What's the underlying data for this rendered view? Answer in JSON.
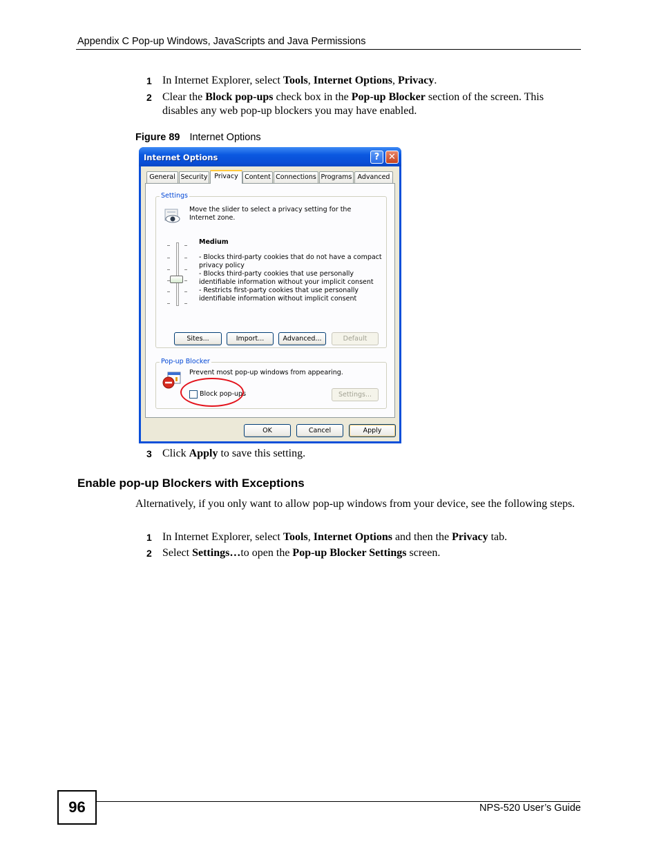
{
  "header": {
    "title": "Appendix C Pop-up Windows, JavaScripts and Java Permissions"
  },
  "steps_a": [
    {
      "num": "1",
      "parts": [
        {
          "t": "In Internet Explorer, select "
        },
        {
          "t": "Tools",
          "b": true
        },
        {
          "t": ", "
        },
        {
          "t": "Internet Options",
          "b": true
        },
        {
          "t": ", "
        },
        {
          "t": "Privacy",
          "b": true
        },
        {
          "t": "."
        }
      ]
    },
    {
      "num": "2",
      "parts": [
        {
          "t": "Clear the "
        },
        {
          "t": "Block pop-ups",
          "b": true
        },
        {
          "t": " check box in the "
        },
        {
          "t": "Pop-up Blocker",
          "b": true
        },
        {
          "t": " section of the screen. This disables any web pop-up blockers you may have enabled."
        }
      ]
    }
  ],
  "figure": {
    "label": "Figure 89",
    "title": "Internet Options"
  },
  "dialog": {
    "title": "Internet Options",
    "help_glyph": "?",
    "close_glyph": "✕",
    "tabs": [
      "General",
      "Security",
      "Privacy",
      "Content",
      "Connections",
      "Programs",
      "Advanced"
    ],
    "selected_tab": "Privacy",
    "settings": {
      "group_label": "Settings",
      "intro": "Move the slider to select a privacy setting for the Internet zone.",
      "level": "Medium",
      "descriptions": [
        "- Blocks third-party cookies that do not have a compact privacy policy",
        "- Blocks third-party cookies that use personally identifiable information without your implicit consent",
        "- Restricts first-party cookies that use personally identifiable information without implicit consent"
      ],
      "buttons": {
        "sites": "Sites...",
        "import": "Import...",
        "advanced": "Advanced...",
        "default": "Default"
      }
    },
    "popup_blocker": {
      "group_label": "Pop-up Blocker",
      "text": "Prevent most pop-up windows from appearing.",
      "checkbox_label": "Block pop-ups",
      "checkbox_checked": false,
      "settings_button": "Settings..."
    },
    "footer_buttons": {
      "ok": "OK",
      "cancel": "Cancel",
      "apply": "Apply"
    }
  },
  "step_3": {
    "num": "3",
    "parts": [
      {
        "t": "Click "
      },
      {
        "t": "Apply",
        "b": true
      },
      {
        "t": " to save this setting."
      }
    ]
  },
  "section": {
    "heading": "Enable pop-up Blockers with Exceptions",
    "paragraph": "Alternatively, if you only want to allow pop-up windows from your device, see the following steps."
  },
  "steps_b": [
    {
      "num": "1",
      "parts": [
        {
          "t": "In Internet Explorer, select "
        },
        {
          "t": "Tools",
          "b": true
        },
        {
          "t": ", "
        },
        {
          "t": "Internet Options",
          "b": true
        },
        {
          "t": " and then the "
        },
        {
          "t": "Privacy",
          "b": true
        },
        {
          "t": " tab."
        }
      ]
    },
    {
      "num": "2",
      "parts": [
        {
          "t": "Select "
        },
        {
          "t": "Settings…",
          "b": true
        },
        {
          "t": "to open the "
        },
        {
          "t": "Pop-up Blocker Settings",
          "b": true
        },
        {
          "t": " screen."
        }
      ]
    }
  ],
  "footer": {
    "page_number": "96",
    "guide": "NPS-520 User’s Guide"
  },
  "colors": {
    "annotation_ellipse": "#e3121b",
    "xp_title_blue": "#0a4fd9",
    "group_label_blue": "#0046d5"
  }
}
